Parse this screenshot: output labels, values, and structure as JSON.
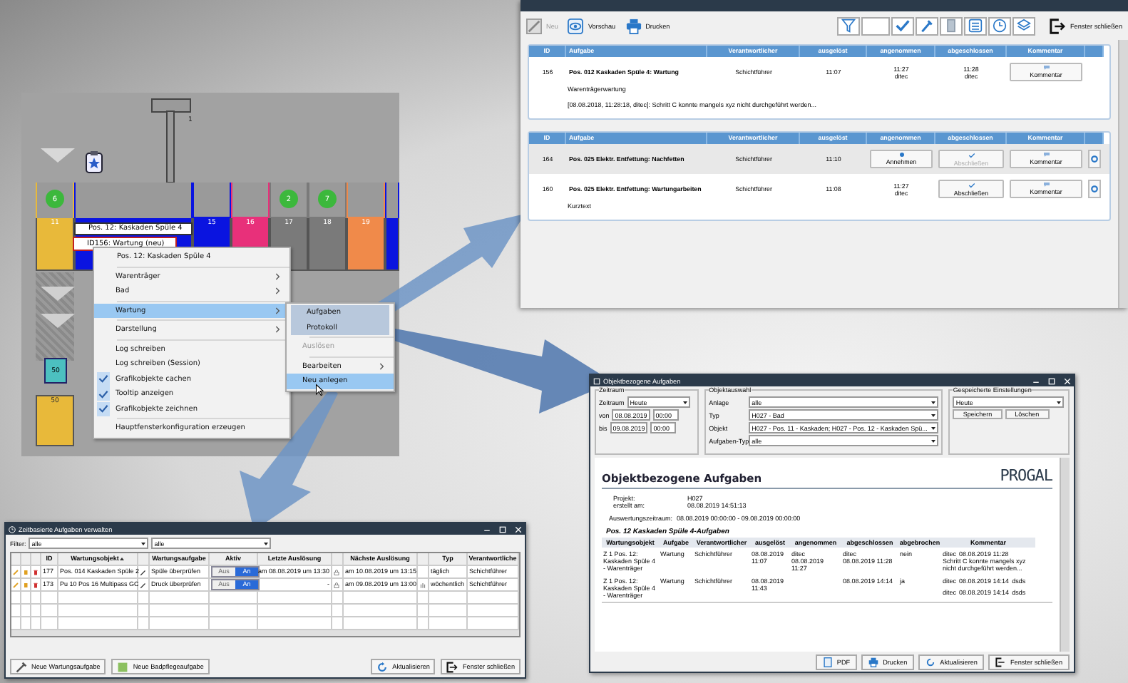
{
  "plant_view": {
    "crane_number": "1",
    "stations": [
      {
        "kind": "station",
        "number": "11",
        "color": "#e8b93a",
        "badge": "6"
      },
      {
        "kind": "group",
        "color": "#0a14e0"
      },
      {
        "kind": "station",
        "number": "15",
        "color": "#0a14e0"
      },
      {
        "kind": "station",
        "number": "16",
        "color": "#e8307a"
      },
      {
        "kind": "station",
        "number": "17",
        "color": "#7a7a7a",
        "badge": "2"
      },
      {
        "kind": "station",
        "number": "18",
        "color": "#7a7a7a",
        "badge": "7"
      },
      {
        "kind": "station",
        "number": "19",
        "color": "#f08a4a"
      },
      {
        "kind": "edge",
        "color": "#0a14e0"
      }
    ],
    "position_label": "Pos. 12: Kaskaden Spüle 4",
    "task_label": "ID156: Wartung (neu)",
    "carrier_count": "50",
    "bottom_station": "50"
  },
  "context_menu": {
    "items": [
      {
        "kind": "header",
        "label": "Pos. 12: Kaskaden Spüle 4"
      },
      {
        "kind": "separator"
      },
      {
        "kind": "submenu",
        "label": "Warenträger",
        "selected": false
      },
      {
        "kind": "submenu",
        "label": "Bad",
        "selected": false
      },
      {
        "kind": "separator"
      },
      {
        "kind": "submenu",
        "label": "Wartung",
        "selected": true
      },
      {
        "kind": "separator"
      },
      {
        "kind": "submenu",
        "label": "Darstellung",
        "selected": false
      },
      {
        "kind": "separator"
      },
      {
        "kind": "item",
        "label": "Log schreiben"
      },
      {
        "kind": "item",
        "label": "Log schreiben (Session)"
      },
      {
        "kind": "check",
        "label": "Grafikobjekte cachen",
        "checked": true
      },
      {
        "kind": "check",
        "label": "Tooltip anzeigen",
        "checked": true
      },
      {
        "kind": "check",
        "label": "Grafikobjekte zeichnen",
        "checked": true
      },
      {
        "kind": "separator"
      },
      {
        "kind": "item",
        "label": "Hauptfensterkonfiguration erzeugen"
      }
    ]
  },
  "submenu": {
    "items": [
      {
        "kind": "item",
        "label": "Aufgaben",
        "marked": true,
        "hovered": false,
        "disabled": false
      },
      {
        "kind": "item",
        "label": "Protokoll",
        "marked": true,
        "hovered": false,
        "disabled": false
      },
      {
        "kind": "separator"
      },
      {
        "kind": "item",
        "label": "Auslösen",
        "marked": false,
        "hovered": false,
        "disabled": true
      },
      {
        "kind": "separator"
      },
      {
        "kind": "submenu",
        "label": "Bearbeiten",
        "marked": false,
        "hovered": false,
        "disabled": false
      },
      {
        "kind": "item",
        "label": "Neu anlegen",
        "marked": false,
        "hovered": true,
        "disabled": false
      }
    ]
  },
  "task_panel": {
    "toolbar": {
      "new_button": {
        "label": "Neu",
        "disabled": true
      },
      "preview_button": "Vorschau",
      "print_button": "Drucken",
      "close_button": "Fenster schließen"
    },
    "tables": [
      {
        "columns": [
          "ID",
          "Aufgabe",
          "Verantwortlicher",
          "ausgelöst",
          "angenommen",
          "abgeschlossen",
          "Kommentar"
        ],
        "rows": [
          {
            "id": "156",
            "task": "Pos. 012 Kaskaden Spüle 4: Wartung",
            "responsible": "Schichtführer",
            "triggered": "11:07",
            "selected": false,
            "settings": false,
            "accepted": {
              "kind": "stamp",
              "time": "11:27",
              "user": "ditec"
            },
            "completed": {
              "kind": "stamp",
              "time": "11:28",
              "user": "ditec"
            },
            "comment": {
              "kind": "comment",
              "label": "Kommentar",
              "disabled": false
            },
            "notes": [
              "Warenträgerwartung",
              "[08.08.2018, 11:28:18, ditec]: Schritt C konnte mangels xyz nicht durchgeführt werden..."
            ]
          }
        ]
      },
      {
        "columns": [
          "ID",
          "Aufgabe",
          "Verantwortlicher",
          "ausgelöst",
          "angenommen",
          "abgeschlossen",
          "Kommentar"
        ],
        "rows": [
          {
            "id": "164",
            "task": "Pos. 025 Elektr. Entfettung: Nachfetten",
            "responsible": "Schichtführer",
            "triggered": "11:10",
            "selected": true,
            "settings": true,
            "accepted": {
              "kind": "accept",
              "label": "Annehmen",
              "disabled": false
            },
            "completed": {
              "kind": "complete",
              "label": "Abschließen",
              "disabled": true
            },
            "comment": {
              "kind": "comment",
              "label": "Kommentar",
              "disabled": false
            }
          },
          {
            "id": "160",
            "task": "Pos. 025 Elektr. Entfettung: Wartungarbeiten",
            "responsible": "Schichtführer",
            "triggered": "11:08",
            "selected": false,
            "settings": true,
            "accepted": {
              "kind": "stamp",
              "time": "11:27",
              "user": "ditec"
            },
            "completed": {
              "kind": "complete",
              "label": "Abschließen",
              "disabled": false
            },
            "comment": {
              "kind": "comment",
              "label": "Kommentar",
              "disabled": false
            },
            "notes": [
              "Kurztext"
            ]
          }
        ]
      }
    ]
  },
  "schedule_window": {
    "title": "Zeitbasierte Aufgaben verwalten",
    "filter_label": "Filter:",
    "filters": [
      "alle",
      "alle"
    ],
    "columns": [
      {
        "label": "ID",
        "sorted": false
      },
      {
        "label": "Wartungsobjekt",
        "sorted": true
      },
      {
        "label": "Wartungsaufgabe",
        "sorted": false
      },
      {
        "label": "Aktiv",
        "sorted": false
      },
      {
        "label": "Letzte Auslösung",
        "sorted": false
      },
      {
        "label": "Nächste Auslösung",
        "sorted": false
      },
      {
        "label": "Typ",
        "sorted": false
      },
      {
        "label": "Verantwortliche",
        "sorted": false
      }
    ],
    "rows": [
      {
        "id": "177",
        "object": "Pos. 014 Kaskaden Spüle 2",
        "task": "Spüle überprüfen",
        "off_label": "Aus",
        "on_label": "An",
        "active": true,
        "last": "am 08.08.2019 um 13:30",
        "next": "am 10.08.2019 um 13:15",
        "manual": false,
        "type": "täglich",
        "responsible": "Schichtführer"
      },
      {
        "id": "173",
        "object": "Pu 10 Pos 16 Multipass GC",
        "task": "Druck überprüfen",
        "off_label": "Aus",
        "on_label": "An",
        "active": true,
        "last": "-",
        "next": "am 09.08.2019 um 13:00",
        "manual": true,
        "type": "wöchentlich",
        "responsible": "Schichtführer"
      }
    ],
    "buttons": [
      "Neue Wartungsaufgabe",
      "Neue Badpflegeaufgabe",
      "Aktualisieren",
      "Fenster schließen"
    ]
  },
  "report_window": {
    "title": "Objektbezogene Aufgaben",
    "period": {
      "legend": "Zeitraum",
      "range_label": "Zeitraum",
      "range": "Heute",
      "from_label": "von",
      "from_date": "08.08.2019",
      "from_time": "00:00",
      "to_label": "bis",
      "to_date": "09.08.2019",
      "to_time": "00:00"
    },
    "selection": {
      "legend": "Objektauswahl",
      "fields": [
        {
          "label": "Anlage",
          "value": "alle"
        },
        {
          "label": "Typ",
          "value": "H027 - Bad"
        },
        {
          "label": "Objekt",
          "value": "H027 - Pos. 11 - Kaskaden; H027 - Pos. 12 - Kaskaden Spü..."
        },
        {
          "label": "Aufgaben-Typ",
          "value": "alle"
        }
      ]
    },
    "saved": {
      "legend": "Gespeicherte Einstellungen",
      "value": "Heute",
      "buttons": [
        "Speichern",
        "Löschen"
      ]
    },
    "report": {
      "title": "Objektbezogene Aufgaben",
      "logo": "PROGAL",
      "project_label": "Projekt:",
      "project": "H027",
      "created_label": "erstellt am:",
      "created": "08.08.2019 14:51:13",
      "period_label": "Auswertungszeitraum:",
      "period": "08.08.2019 00:00:00 - 09.08.2019 00:00:00",
      "section": "Pos. 12 Kaskaden Spüle 4-Aufgaben",
      "columns": [
        "Wartungsobjekt",
        "Aufgabe",
        "Verantwortlicher",
        "ausgelöst",
        "angenommen",
        "abgeschlossen",
        "abgebrochen",
        "Kommentar"
      ],
      "rows": [
        {
          "object": "Z 1 Pos. 12: Kaskaden Spüle 4 - Warenträger",
          "task": "Wartung",
          "responsible": "Schichtführer",
          "triggered": "08.08.2019 11:07",
          "accepted_user": "ditec",
          "accepted": "08.08.2019 11:27",
          "completed_user": "ditec",
          "completed": "08.08.2019 11:28",
          "aborted": "nein",
          "comments": [
            {
              "user": "ditec",
              "time": "08.08.2019 11:28",
              "text": "Schritt C konnte mangels xyz nicht durchgeführt werden..."
            }
          ]
        },
        {
          "object": "Z 1 Pos. 12: Kaskaden Spüle 4 - Warenträger",
          "task": "Wartung",
          "responsible": "Schichtführer",
          "triggered": "08.08.2019 11:43",
          "completed": "08.08.2019 14:14",
          "aborted": "ja",
          "comments": [
            {
              "user": "ditec",
              "time": "08.08.2019 14:14",
              "text": "dsds"
            },
            {
              "user": "ditec",
              "time": "08.08.2019 14:14",
              "text": "dsds"
            }
          ]
        }
      ]
    },
    "buttons": [
      "PDF",
      "Drucken",
      "Aktualisieren",
      "Fenster schließen"
    ]
  }
}
